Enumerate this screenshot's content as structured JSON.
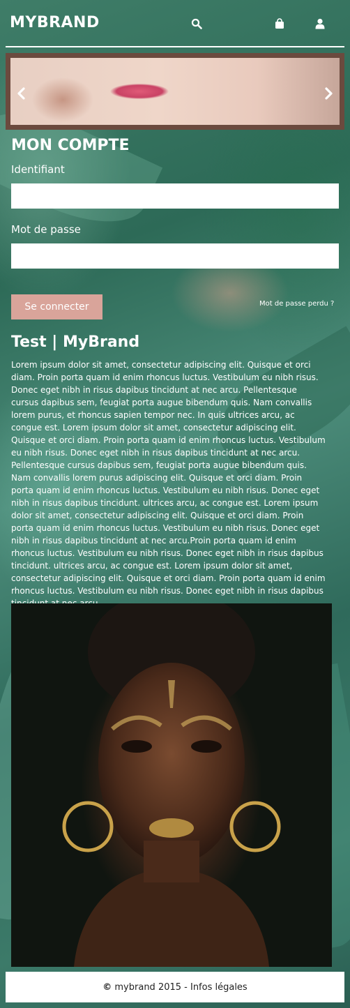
{
  "header": {
    "brand": "MYBRAND",
    "icons": [
      "search-icon",
      "shopping-bag-icon",
      "user-icon"
    ]
  },
  "carousel": {
    "prev_icon": "chevron-left-icon",
    "next_icon": "chevron-right-icon"
  },
  "login": {
    "title": "MON COMPTE",
    "username_label": "Identifiant",
    "username_value": "",
    "password_label": "Mot de passe",
    "password_value": "",
    "submit_label": "Se connecter",
    "forgot_label": "Mot de passe perdu ?"
  },
  "article": {
    "title": "Test | MyBrand",
    "body": "Lorem ipsum dolor sit amet, consectetur adipiscing elit. Quisque et orci diam. Proin porta quam id enim rhoncus luctus. Vestibulum eu nibh risus. Donec eget nibh in risus dapibus tincidunt at nec arcu. Pellentesque cursus dapibus sem, feugiat porta augue bibendum quis. Nam convallis lorem purus, et rhoncus sapien tempor nec. In quis ultrices arcu, ac congue est. Lorem ipsum dolor sit amet, consectetur adipiscing elit. Quisque et orci diam. Proin porta quam id enim rhoncus luctus. Vestibulum eu nibh risus. Donec eget nibh in risus dapibus tincidunt at nec arcu. Pellentesque cursus dapibus sem, feugiat porta augue bibendum quis. Nam convallis lorem purus adipiscing elit. Quisque et orci diam. Proin porta quam id enim rhoncus luctus. Vestibulum eu nibh risus. Donec eget nibh in risus dapibus tincidunt. ultrices arcu, ac congue est. Lorem ipsum dolor sit amet, consectetur adipiscing elit. Quisque et orci diam. Proin porta quam id enim rhoncus luctus. Vestibulum eu nibh risus. Donec eget nibh in risus dapibus tincidunt at nec arcu.Proin porta quam id enim rhoncus luctus. Vestibulum eu nibh risus. Donec eget nibh in risus dapibus tincidunt. ultrices arcu, ac congue est. Lorem ipsum dolor sit amet, consectetur adipiscing elit. Quisque et orci diam. Proin porta quam id enim rhoncus luctus. Vestibulum eu nibh risus. Donec eget nibh in risus dapibus tincidunt at nec arcu."
  },
  "footer": {
    "copyright_symbol": "©",
    "text": " mybrand 2015 - ",
    "legal_link": "Infos légales"
  },
  "colors": {
    "button": "#d9a49a",
    "background": "#3f7d68",
    "footer_bg": "#ffffff"
  }
}
